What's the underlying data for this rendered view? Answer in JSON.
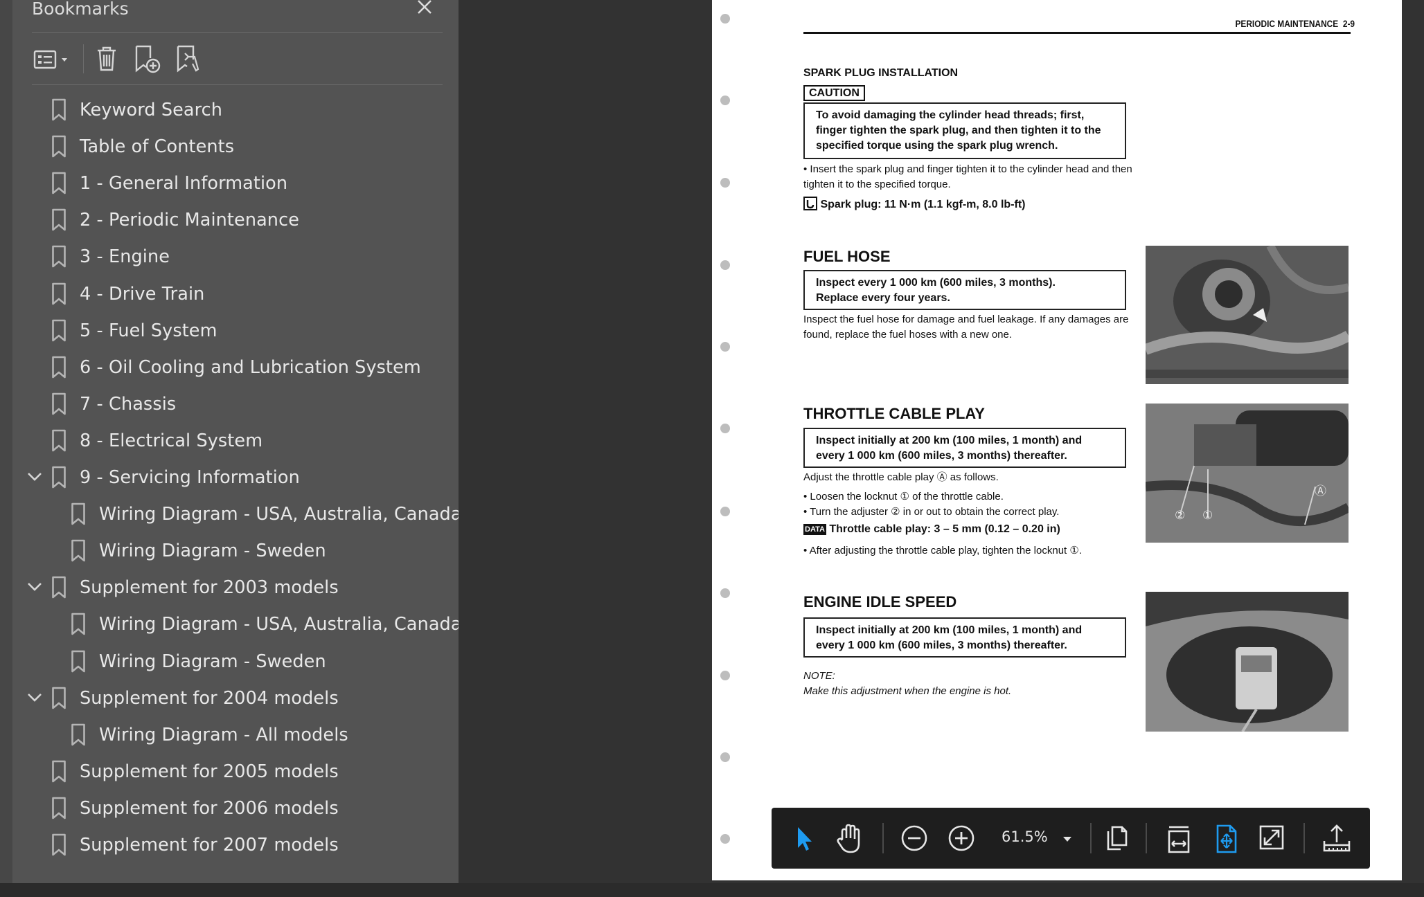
{
  "sidebar": {
    "title": "Bookmarks",
    "toolbar": {
      "options_icon": "list-options-icon",
      "delete_icon": "trash-icon",
      "add_icon": "add-bookmark-icon",
      "find_icon": "find-bookmark-icon"
    },
    "items": [
      {
        "label": "Keyword Search"
      },
      {
        "label": "Table of Contents"
      },
      {
        "label": "1 - General Information"
      },
      {
        "label": "2 - Periodic Maintenance"
      },
      {
        "label": "3 - Engine"
      },
      {
        "label": "4 - Drive Train"
      },
      {
        "label": "5 - Fuel System"
      },
      {
        "label": "6 - Oil Cooling and Lubrication System"
      },
      {
        "label": "7 - Chassis"
      },
      {
        "label": "8 - Electrical System"
      },
      {
        "label": "9 - Servicing Information"
      },
      {
        "label": "Wiring Diagram - USA, Australia, Canada"
      },
      {
        "label": "Wiring Diagram - Sweden"
      },
      {
        "label": "Supplement for 2003 models"
      },
      {
        "label": "Wiring Diagram - USA, Australia, Canada"
      },
      {
        "label": "Wiring Diagram - Sweden"
      },
      {
        "label": "Supplement for 2004 models"
      },
      {
        "label": "Wiring Diagram - All models"
      },
      {
        "label": "Supplement for 2005 models"
      },
      {
        "label": "Supplement for 2006 models"
      },
      {
        "label": "Supplement for 2007 models"
      }
    ]
  },
  "document": {
    "header": "PERIODIC MAINTENANCE",
    "page_no": "2-9",
    "spark": {
      "title": "SPARK PLUG INSTALLATION",
      "caution": "CAUTION",
      "warning_box": "To avoid damaging the cylinder head threads; first, finger tighten the spark plug, and then tighten it to the specified torque using the spark plug wrench.",
      "bullet": "Insert the spark plug and finger tighten it to the cylinder head and then tighten it to the specified torque.",
      "spec": "Spark plug: 11 N·m (1.1 kgf-m, 8.0 lb-ft)"
    },
    "fuel": {
      "title": "FUEL HOSE",
      "box_line1": "Inspect every 1 000 km (600 miles, 3 months).",
      "box_line2": "Replace every four years.",
      "text": "Inspect the fuel hose for damage and fuel leakage. If any damages are found, replace the fuel hoses with a new one."
    },
    "throttle": {
      "title": "THROTTLE CABLE PLAY",
      "box": "Inspect initially at 200 km (100 miles, 1 month) and every 1 000 km (600 miles, 3 months) thereafter.",
      "intro": "Adjust the throttle cable play Ⓐ as follows.",
      "bullet1": "Loosen the locknut ① of the throttle cable.",
      "bullet2": "Turn the adjuster ② in or out to obtain the correct play.",
      "data_tag": "DATA",
      "spec": "Throttle cable play: 3 – 5 mm (0.12 – 0.20 in)",
      "bullet3": "After adjusting the throttle cable play, tighten the locknut ①.",
      "photo_labels": [
        "②",
        "①",
        "Ⓐ"
      ]
    },
    "idle": {
      "title": "ENGINE IDLE SPEED",
      "box": "Inspect initially at 200 km (100 miles, 1 month) and every 1 000 km (600 miles, 3 months) thereafter.",
      "note_label": "NOTE:",
      "note": "Make this adjustment when the engine is hot."
    }
  },
  "floating_toolbar": {
    "zoom": "61.5%",
    "icons": [
      "select-arrow-icon",
      "hand-tool-icon",
      "zoom-out-icon",
      "zoom-in-icon",
      "page-display-icon",
      "fit-width-icon",
      "fit-page-icon",
      "fullscreen-icon",
      "share-icon"
    ],
    "accent": "#1e9bf0"
  }
}
